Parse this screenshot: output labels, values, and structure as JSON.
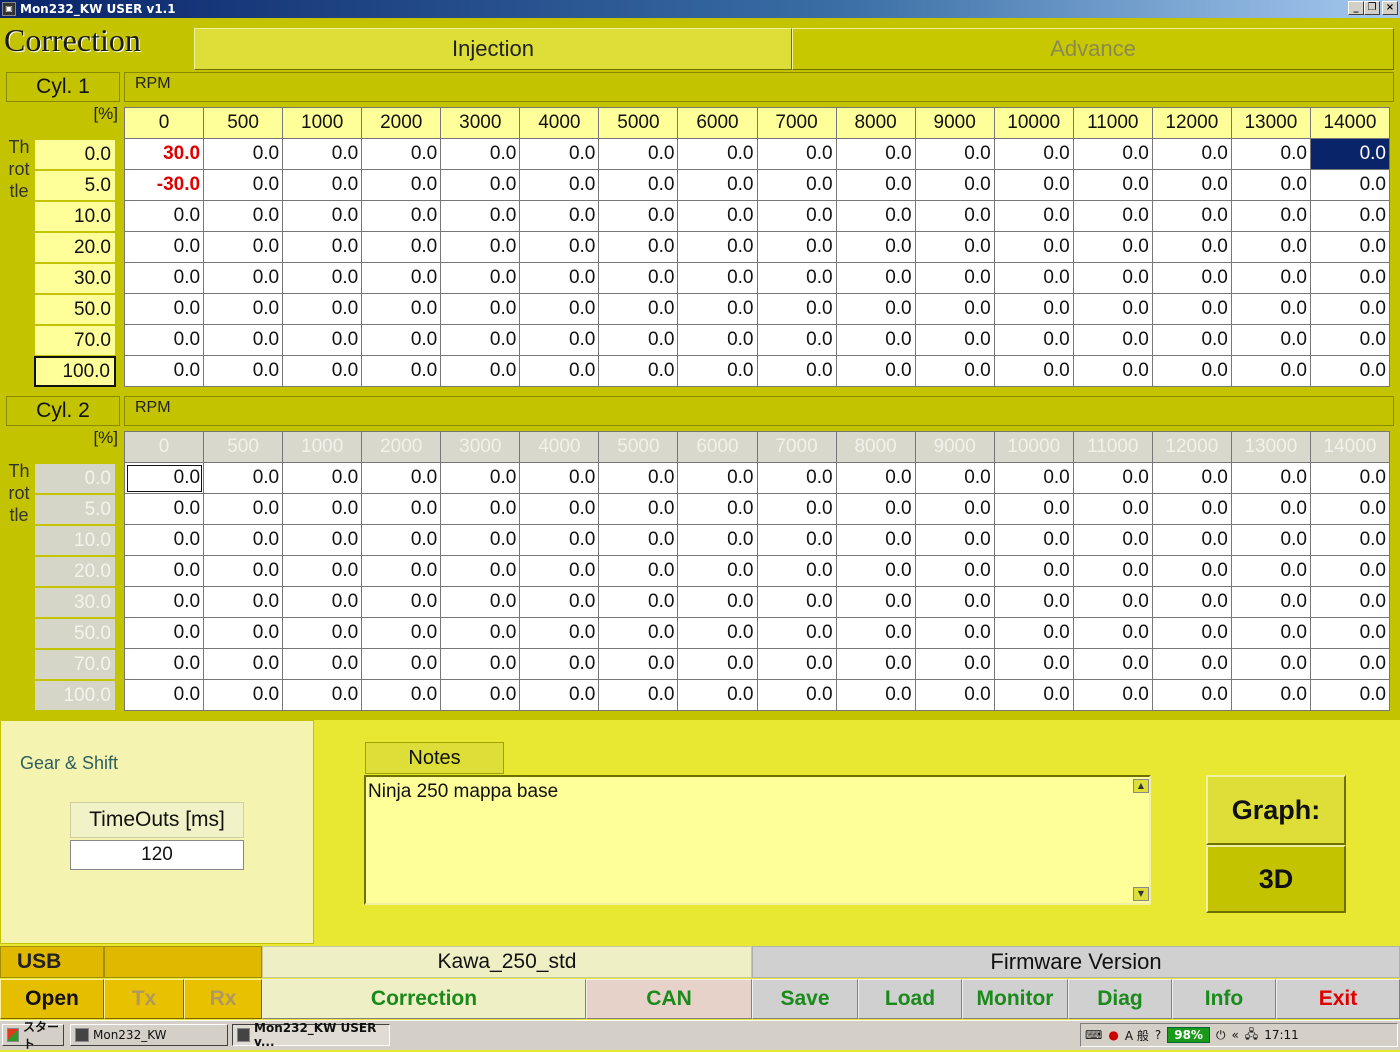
{
  "window": {
    "title": "Mon232_KW USER v1.1"
  },
  "header": {
    "title": "Correction",
    "tabs": [
      {
        "label": "Injection"
      },
      {
        "label": "Advance"
      }
    ]
  },
  "rpm_columns": [
    "0",
    "500",
    "1000",
    "2000",
    "3000",
    "4000",
    "5000",
    "6000",
    "7000",
    "8000",
    "9000",
    "10000",
    "11000",
    "12000",
    "13000",
    "14000"
  ],
  "throttle_rows": [
    "0.0",
    "5.0",
    "10.0",
    "20.0",
    "30.0",
    "50.0",
    "70.0",
    "100.0"
  ],
  "cyl1": {
    "label": "Cyl. 1",
    "axis_label": "RPM",
    "unit_label": "[%]",
    "throttle_label": "Throttle",
    "cells": [
      [
        "30.0",
        "0.0",
        "0.0",
        "0.0",
        "0.0",
        "0.0",
        "0.0",
        "0.0",
        "0.0",
        "0.0",
        "0.0",
        "0.0",
        "0.0",
        "0.0",
        "0.0",
        "0.0"
      ],
      [
        "-30.0",
        "0.0",
        "0.0",
        "0.0",
        "0.0",
        "0.0",
        "0.0",
        "0.0",
        "0.0",
        "0.0",
        "0.0",
        "0.0",
        "0.0",
        "0.0",
        "0.0",
        "0.0"
      ],
      [
        "0.0",
        "0.0",
        "0.0",
        "0.0",
        "0.0",
        "0.0",
        "0.0",
        "0.0",
        "0.0",
        "0.0",
        "0.0",
        "0.0",
        "0.0",
        "0.0",
        "0.0",
        "0.0"
      ],
      [
        "0.0",
        "0.0",
        "0.0",
        "0.0",
        "0.0",
        "0.0",
        "0.0",
        "0.0",
        "0.0",
        "0.0",
        "0.0",
        "0.0",
        "0.0",
        "0.0",
        "0.0",
        "0.0"
      ],
      [
        "0.0",
        "0.0",
        "0.0",
        "0.0",
        "0.0",
        "0.0",
        "0.0",
        "0.0",
        "0.0",
        "0.0",
        "0.0",
        "0.0",
        "0.0",
        "0.0",
        "0.0",
        "0.0"
      ],
      [
        "0.0",
        "0.0",
        "0.0",
        "0.0",
        "0.0",
        "0.0",
        "0.0",
        "0.0",
        "0.0",
        "0.0",
        "0.0",
        "0.0",
        "0.0",
        "0.0",
        "0.0",
        "0.0"
      ],
      [
        "0.0",
        "0.0",
        "0.0",
        "0.0",
        "0.0",
        "0.0",
        "0.0",
        "0.0",
        "0.0",
        "0.0",
        "0.0",
        "0.0",
        "0.0",
        "0.0",
        "0.0",
        "0.0"
      ],
      [
        "0.0",
        "0.0",
        "0.0",
        "0.0",
        "0.0",
        "0.0",
        "0.0",
        "0.0",
        "0.0",
        "0.0",
        "0.0",
        "0.0",
        "0.0",
        "0.0",
        "0.0",
        "0.0"
      ]
    ]
  },
  "cyl2": {
    "label": "Cyl. 2",
    "axis_label": "RPM",
    "unit_label": "[%]",
    "throttle_label": "Throttle",
    "cells": [
      [
        "0.0",
        "0.0",
        "0.0",
        "0.0",
        "0.0",
        "0.0",
        "0.0",
        "0.0",
        "0.0",
        "0.0",
        "0.0",
        "0.0",
        "0.0",
        "0.0",
        "0.0",
        "0.0"
      ],
      [
        "0.0",
        "0.0",
        "0.0",
        "0.0",
        "0.0",
        "0.0",
        "0.0",
        "0.0",
        "0.0",
        "0.0",
        "0.0",
        "0.0",
        "0.0",
        "0.0",
        "0.0",
        "0.0"
      ],
      [
        "0.0",
        "0.0",
        "0.0",
        "0.0",
        "0.0",
        "0.0",
        "0.0",
        "0.0",
        "0.0",
        "0.0",
        "0.0",
        "0.0",
        "0.0",
        "0.0",
        "0.0",
        "0.0"
      ],
      [
        "0.0",
        "0.0",
        "0.0",
        "0.0",
        "0.0",
        "0.0",
        "0.0",
        "0.0",
        "0.0",
        "0.0",
        "0.0",
        "0.0",
        "0.0",
        "0.0",
        "0.0",
        "0.0"
      ],
      [
        "0.0",
        "0.0",
        "0.0",
        "0.0",
        "0.0",
        "0.0",
        "0.0",
        "0.0",
        "0.0",
        "0.0",
        "0.0",
        "0.0",
        "0.0",
        "0.0",
        "0.0",
        "0.0"
      ],
      [
        "0.0",
        "0.0",
        "0.0",
        "0.0",
        "0.0",
        "0.0",
        "0.0",
        "0.0",
        "0.0",
        "0.0",
        "0.0",
        "0.0",
        "0.0",
        "0.0",
        "0.0",
        "0.0"
      ],
      [
        "0.0",
        "0.0",
        "0.0",
        "0.0",
        "0.0",
        "0.0",
        "0.0",
        "0.0",
        "0.0",
        "0.0",
        "0.0",
        "0.0",
        "0.0",
        "0.0",
        "0.0",
        "0.0"
      ],
      [
        "0.0",
        "0.0",
        "0.0",
        "0.0",
        "0.0",
        "0.0",
        "0.0",
        "0.0",
        "0.0",
        "0.0",
        "0.0",
        "0.0",
        "0.0",
        "0.0",
        "0.0",
        "0.0"
      ]
    ]
  },
  "gear": {
    "title": "Gear & Shift",
    "timeouts_label": "TimeOuts [ms]",
    "timeouts_value": "120"
  },
  "notes": {
    "tab_label": "Notes",
    "text": "Ninja 250 mappa base"
  },
  "graph": {
    "label": "Graph:",
    "mode": "3D"
  },
  "status": {
    "port": "USB",
    "map_name": "Kawa_250_std",
    "firmware_label": "Firmware Version"
  },
  "buttons": {
    "open": "Open",
    "tx": "Tx",
    "rx": "Rx",
    "correction": "Correction",
    "can": "CAN",
    "save": "Save",
    "load": "Load",
    "monitor": "Monitor",
    "diag": "Diag",
    "info": "Info",
    "exit": "Exit"
  },
  "taskbar": {
    "start": "スタート",
    "item1": "Mon232_KW",
    "item2": "Mon232_KW USER v...",
    "battery": "98%",
    "clock": "17:11",
    "ime": "A 般"
  },
  "colors": {
    "panel": "#c3c300",
    "background": "#e8e832",
    "highlight": "#0a246a",
    "negative_value": "#e00000"
  }
}
